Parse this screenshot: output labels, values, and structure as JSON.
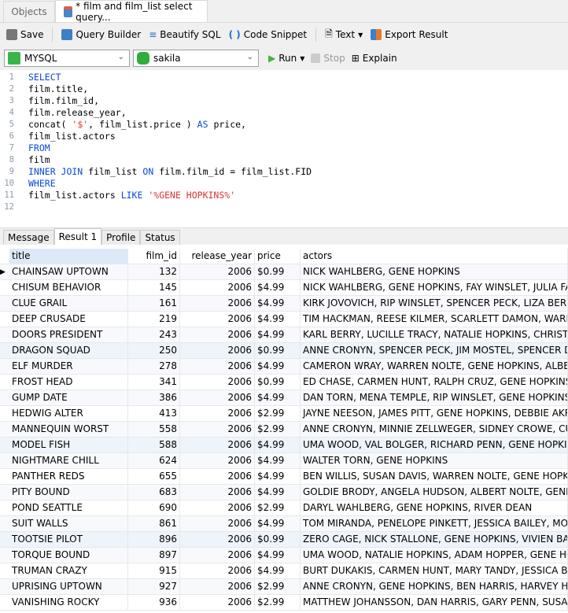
{
  "tabs": [
    {
      "label": "Objects"
    },
    {
      "label": "* film and film_list select query..."
    }
  ],
  "toolbar": {
    "save": "Save",
    "query_builder": "Query Builder",
    "beautify": "Beautify SQL",
    "snippet": "Code Snippet",
    "text": "Text",
    "export": "Export Result"
  },
  "connection": {
    "engine": "MYSQL",
    "database": "sakila",
    "run": "Run",
    "stop": "Stop",
    "explain": "Explain"
  },
  "editor": {
    "lines": [
      "SELECT",
      "film.title,",
      "film.film_id,",
      "film.release_year,",
      "concat( '$', film_list.price ) AS price,",
      "film_list.actors",
      "FROM",
      "film",
      "INNER JOIN film_list ON film.film_id = film_list.FID",
      "WHERE",
      "film_list.actors LIKE '%GENE HOPKINS%'",
      ""
    ]
  },
  "result_tabs": [
    "Message",
    "Result 1",
    "Profile",
    "Status"
  ],
  "grid": {
    "columns": [
      "title",
      "film_id",
      "release_year",
      "price",
      "actors"
    ],
    "rows": [
      [
        "CHAINSAW UPTOWN",
        "132",
        "2006",
        "$0.99",
        "NICK WAHLBERG, GENE HOPKINS"
      ],
      [
        "CHISUM BEHAVIOR",
        "145",
        "2006",
        "$4.99",
        "NICK WAHLBERG, GENE HOPKINS, FAY WINSLET, JULIA FAWCET"
      ],
      [
        "CLUE GRAIL",
        "161",
        "2006",
        "$4.99",
        "KIRK JOVOVICH, RIP WINSLET, SPENCER PECK, LIZA BERGMAN,"
      ],
      [
        "DEEP CRUSADE",
        "219",
        "2006",
        "$4.99",
        "TIM HACKMAN, REESE KILMER, SCARLETT DAMON, WARREN N"
      ],
      [
        "DOORS PRESIDENT",
        "243",
        "2006",
        "$4.99",
        "KARL BERRY, LUCILLE TRACY, NATALIE HOPKINS, CHRISTIAN A"
      ],
      [
        "DRAGON SQUAD",
        "250",
        "2006",
        "$0.99",
        "ANNE CRONYN, SPENCER PECK, JIM MOSTEL, SPENCER DEPP, S"
      ],
      [
        "ELF MURDER",
        "278",
        "2006",
        "$4.99",
        "CAMERON WRAY, WARREN NOLTE, GENE HOPKINS, ALBERT JO"
      ],
      [
        "FROST HEAD",
        "341",
        "2006",
        "$0.99",
        "ED CHASE, CARMEN HUNT, RALPH CRUZ, GENE HOPKINS, CAT"
      ],
      [
        "GUMP DATE",
        "386",
        "2006",
        "$4.99",
        "DAN TORN, MENA TEMPLE, RIP WINSLET, GENE HOPKINS, RIVE"
      ],
      [
        "HEDWIG ALTER",
        "413",
        "2006",
        "$2.99",
        "JAYNE NEESON, JAMES PITT, GENE HOPKINS, DEBBIE AKROYD"
      ],
      [
        "MANNEQUIN WORST",
        "558",
        "2006",
        "$2.99",
        "ANNE CRONYN, MINNIE ZELLWEGER, SIDNEY CROWE, CUBA AL"
      ],
      [
        "MODEL FISH",
        "588",
        "2006",
        "$4.99",
        "UMA WOOD, VAL BOLGER, RICHARD PENN, GENE HOPKINS, MI"
      ],
      [
        "NIGHTMARE CHILL",
        "624",
        "2006",
        "$4.99",
        "WALTER TORN, GENE HOPKINS"
      ],
      [
        "PANTHER REDS",
        "655",
        "2006",
        "$4.99",
        "BEN WILLIS, SUSAN DAVIS, WARREN NOLTE, GENE HOPKINS, HA"
      ],
      [
        "PITY BOUND",
        "683",
        "2006",
        "$4.99",
        "GOLDIE BRODY, ANGELA HUDSON, ALBERT NOLTE, GENE HOPK"
      ],
      [
        "POND SEATTLE",
        "690",
        "2006",
        "$2.99",
        "DARYL WAHLBERG, GENE HOPKINS, RIVER DEAN"
      ],
      [
        "SUIT WALLS",
        "861",
        "2006",
        "$4.99",
        "TOM MIRANDA, PENELOPE PINKETT, JESSICA BAILEY, MORGAN"
      ],
      [
        "TOOTSIE PILOT",
        "896",
        "2006",
        "$0.99",
        "ZERO CAGE, NICK STALLONE, GENE HOPKINS, VIVIEN BASINGER"
      ],
      [
        "TORQUE BOUND",
        "897",
        "2006",
        "$4.99",
        "UMA WOOD, NATALIE HOPKINS, ADAM HOPPER, GENE HOPKI"
      ],
      [
        "TRUMAN CRAZY",
        "915",
        "2006",
        "$4.99",
        "BURT DUKAKIS, CARMEN HUNT, MARY TANDY, JESSICA BAILEY"
      ],
      [
        "UPRISING UPTOWN",
        "927",
        "2006",
        "$2.99",
        "ANNE CRONYN, GENE HOPKINS, BEN HARRIS, HARVEY HOPE, V"
      ],
      [
        "VANISHING ROCKY",
        "936",
        "2006",
        "$2.99",
        "MATTHEW JOHANSSON, DAN HARRIS, GARY PENN, SUSAN DA"
      ]
    ]
  }
}
